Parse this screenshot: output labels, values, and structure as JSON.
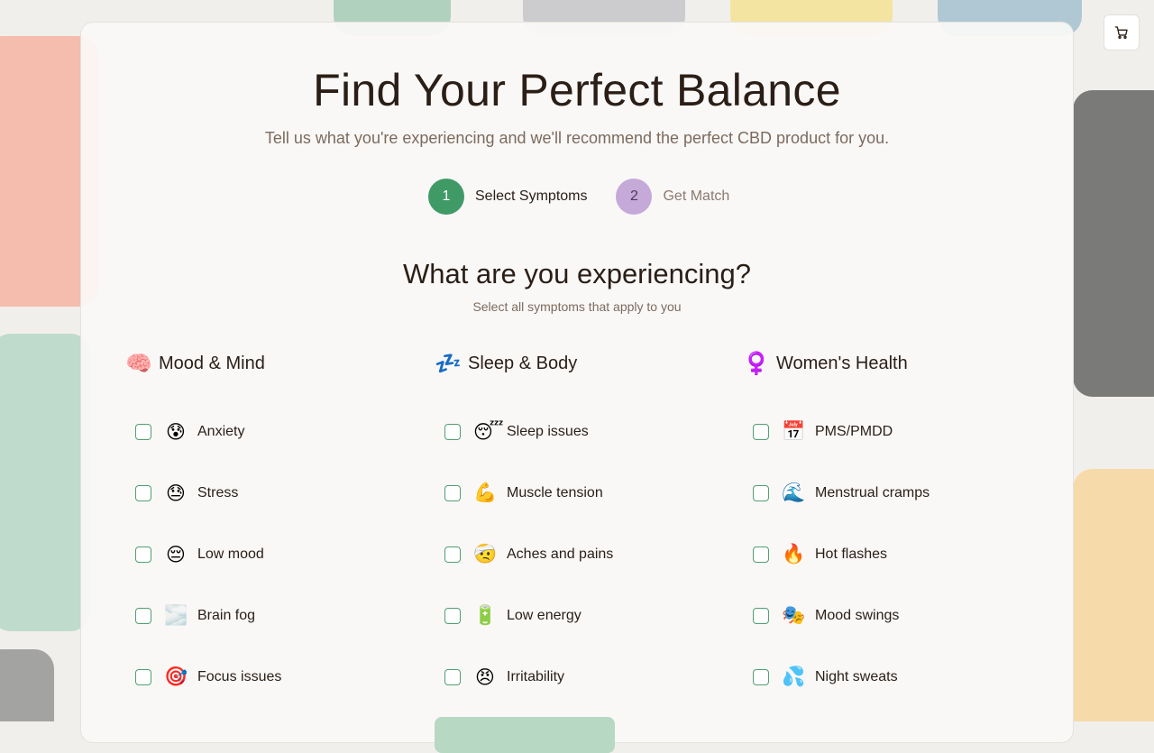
{
  "header": {
    "cart_icon": "shopping-cart-icon"
  },
  "hero": {
    "title": "Find Your Perfect Balance",
    "subtitle": "Tell us what you're experiencing and we'll recommend the perfect CBD product for you."
  },
  "steps": [
    {
      "number": "1",
      "label": "Select Symptoms",
      "state": "active"
    },
    {
      "number": "2",
      "label": "Get Match",
      "state": "inactive"
    }
  ],
  "question": {
    "heading": "What are you experiencing?",
    "subheading": "Select all symptoms that apply to you"
  },
  "categories": [
    {
      "emoji": "🧠",
      "title": "Mood & Mind",
      "items": [
        {
          "emoji": "😰",
          "label": "Anxiety",
          "checked": false
        },
        {
          "emoji": "😓",
          "label": "Stress",
          "checked": false
        },
        {
          "emoji": "😔",
          "label": "Low mood",
          "checked": false
        },
        {
          "emoji": "🌫️",
          "label": "Brain fog",
          "checked": false
        },
        {
          "emoji": "🎯",
          "label": "Focus issues",
          "checked": false
        }
      ]
    },
    {
      "emoji": "💤",
      "title": "Sleep & Body",
      "items": [
        {
          "emoji": "😴",
          "label": "Sleep issues",
          "checked": false
        },
        {
          "emoji": "💪",
          "label": "Muscle tension",
          "checked": false
        },
        {
          "emoji": "🤕",
          "label": "Aches and pains",
          "checked": false
        },
        {
          "emoji": "🔋",
          "label": "Low energy",
          "checked": false
        },
        {
          "emoji": "😠",
          "label": "Irritability",
          "checked": false
        }
      ]
    },
    {
      "emoji": "♀️",
      "title": "Women's Health",
      "items": [
        {
          "emoji": "📅",
          "label": "PMS/PMDD",
          "checked": false
        },
        {
          "emoji": "🌊",
          "label": "Menstrual cramps",
          "checked": false
        },
        {
          "emoji": "🔥",
          "label": "Hot flashes",
          "checked": false
        },
        {
          "emoji": "🎭",
          "label": "Mood swings",
          "checked": false
        },
        {
          "emoji": "💦",
          "label": "Night sweats",
          "checked": false
        }
      ]
    }
  ],
  "colors": {
    "accent_green": "#3f9a66",
    "step_inactive": "#c5a9d9",
    "text_dark": "#2a1e16",
    "text_muted": "#7c6a5d"
  }
}
